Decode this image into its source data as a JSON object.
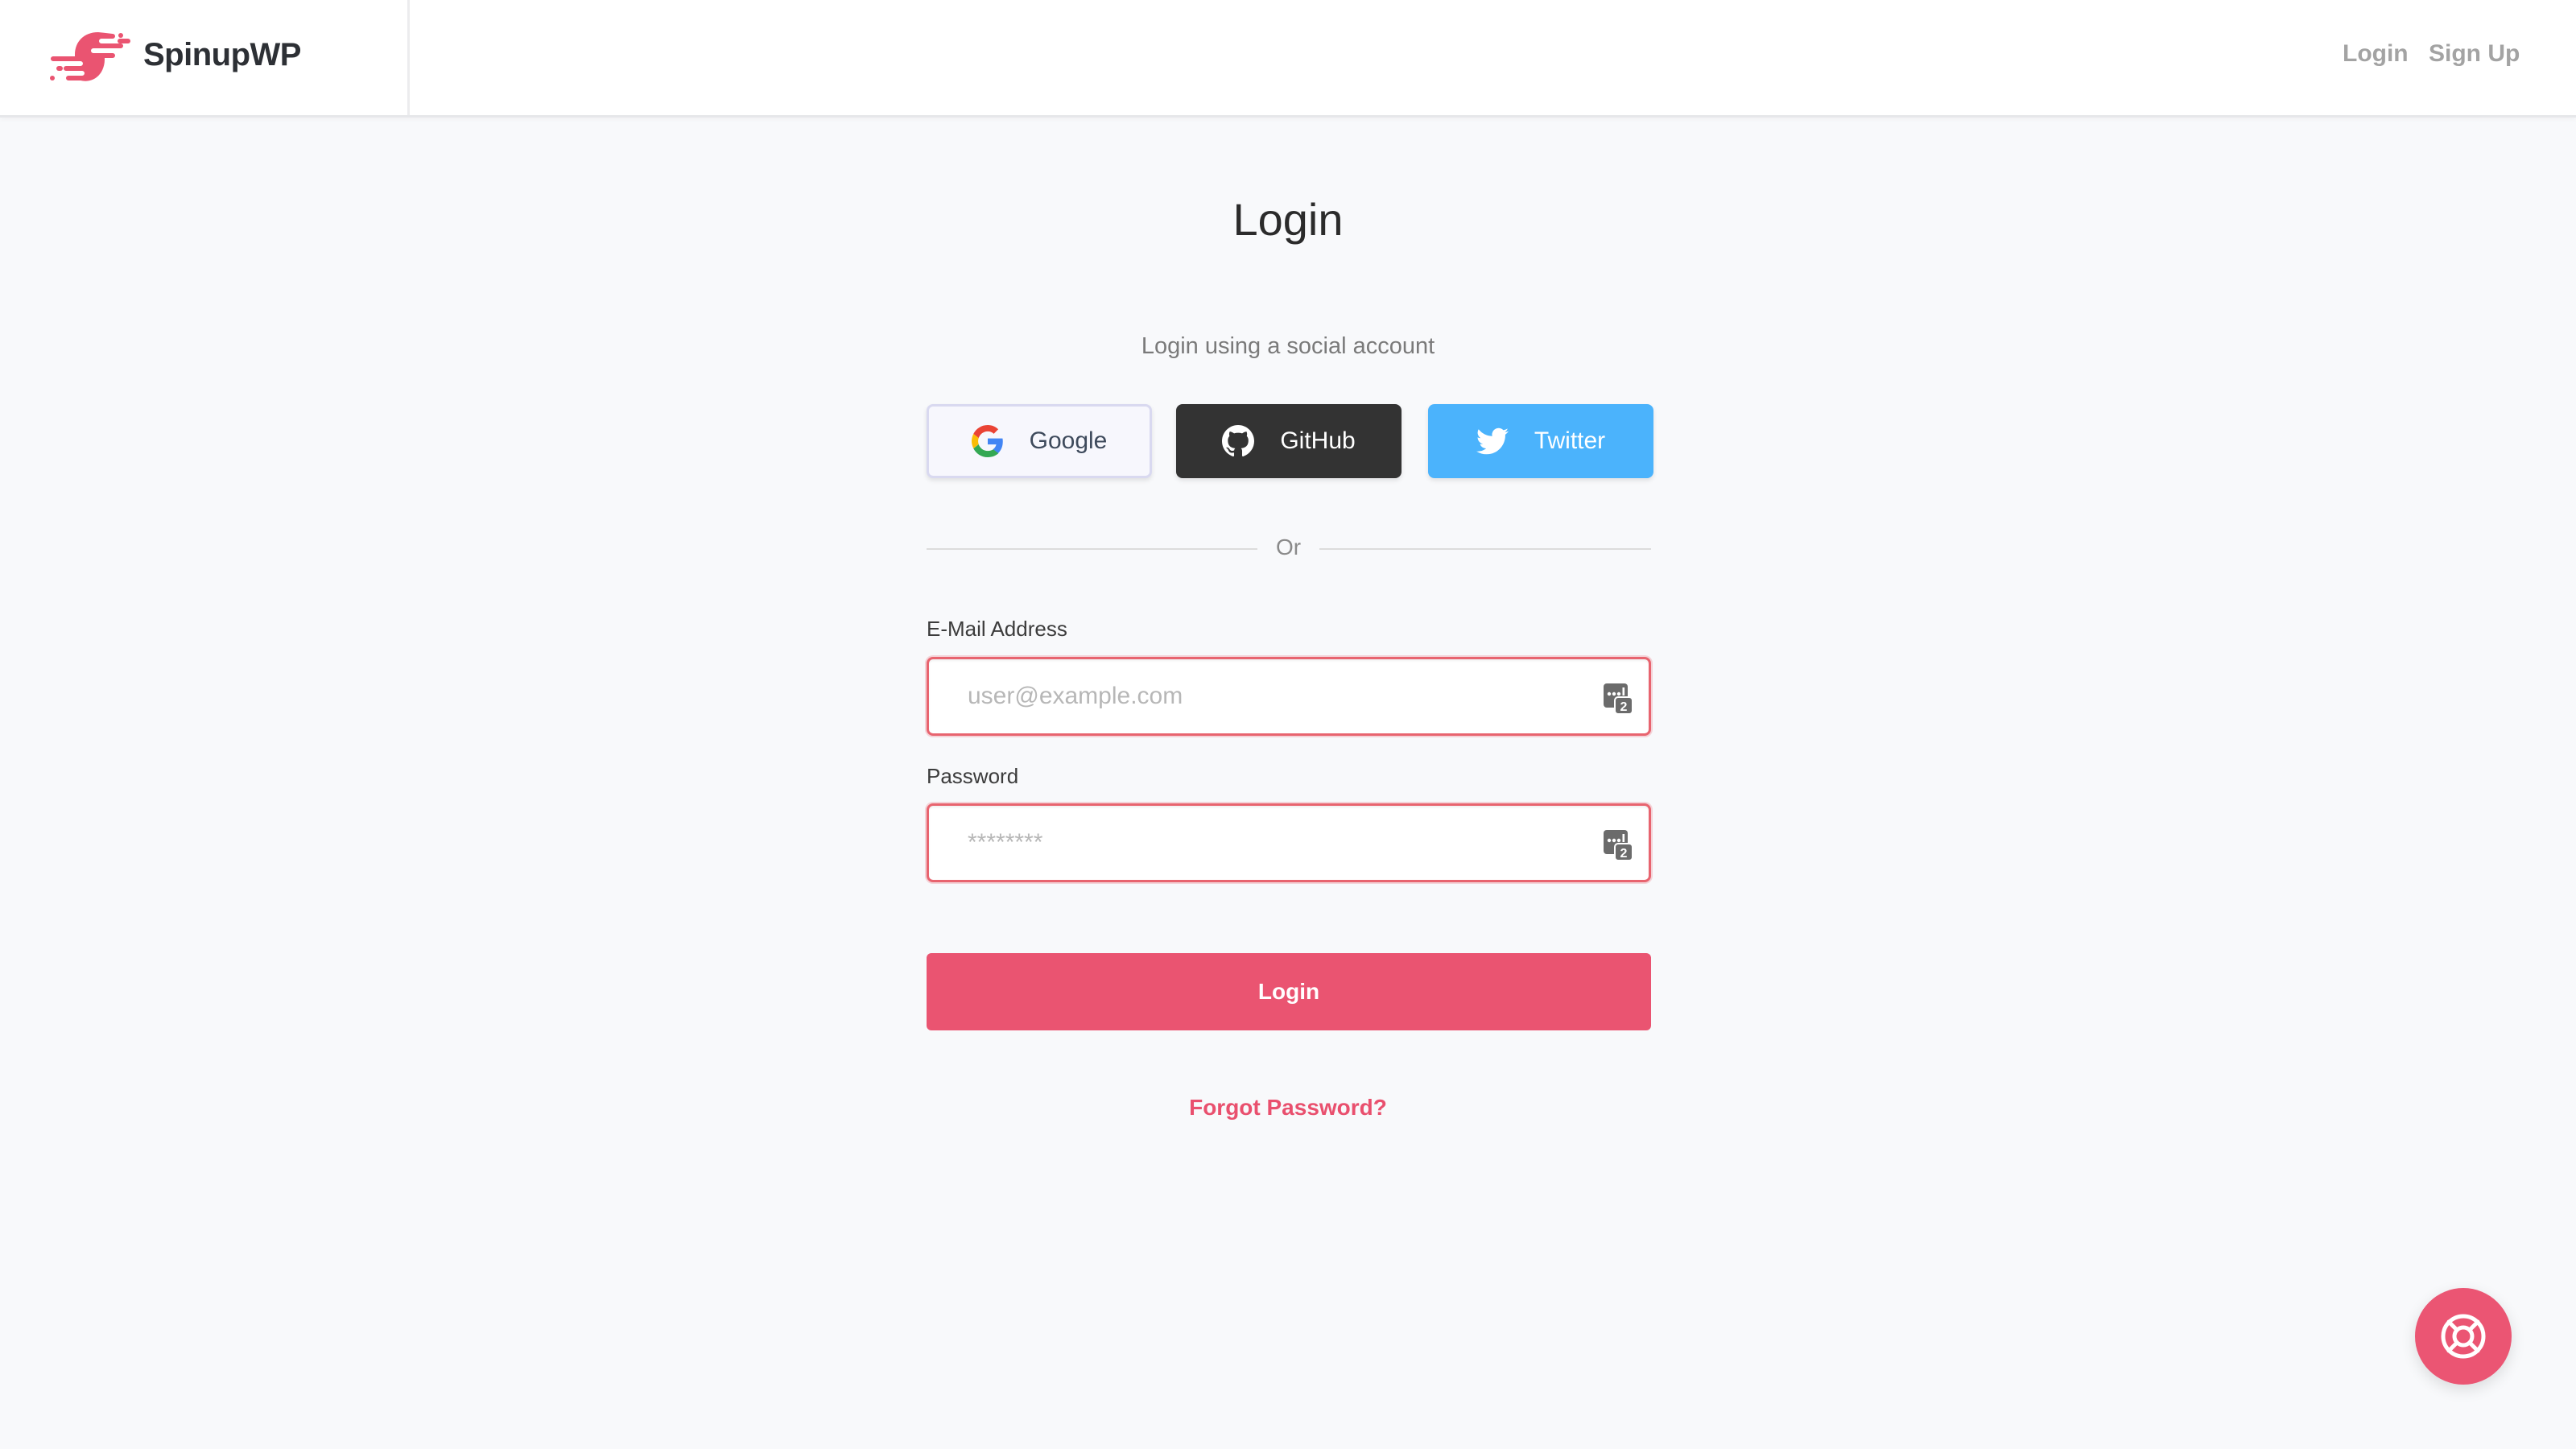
{
  "header": {
    "brand": "SpinupWP",
    "nav": {
      "login": "Login",
      "signup": "Sign Up"
    }
  },
  "page": {
    "title": "Login",
    "social_prompt": "Login using a social account",
    "social_buttons": [
      {
        "label": "Google",
        "icon": "google-icon"
      },
      {
        "label": "GitHub",
        "icon": "github-icon"
      },
      {
        "label": "Twitter",
        "icon": "twitter-icon"
      }
    ],
    "divider_text": "Or"
  },
  "form": {
    "email": {
      "label": "E-Mail Address",
      "value": "",
      "placeholder": "user@example.com"
    },
    "password": {
      "label": "Password",
      "value": "",
      "placeholder": "********"
    },
    "submit_label": "Login",
    "forgot_label": "Forgot Password?"
  },
  "help": {
    "icon": "lifebuoy-icon"
  },
  "colors": {
    "brand": "#ea5471",
    "github": "#333333",
    "twitter": "#4bb3fc",
    "input_error_border": "#e8646f"
  }
}
